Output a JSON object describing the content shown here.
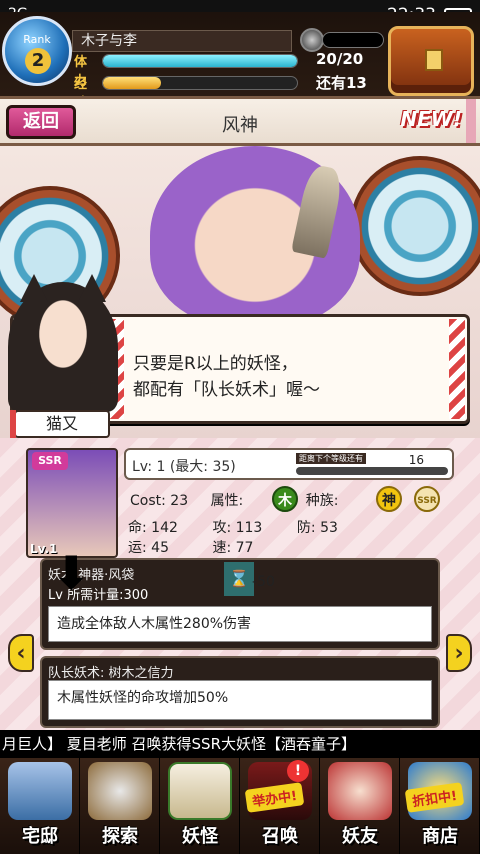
{
  "status_bar": {
    "signal": "2G",
    "time": "22:33"
  },
  "player": {
    "rank_label": "Rank",
    "rank": "2",
    "name": "木子与李",
    "stamina_label": "体力",
    "stamina_value": "20/20",
    "stamina_fraction": 1.0,
    "exp_label": "经验",
    "exp_value": "还有13",
    "exp_fraction": 0.3
  },
  "titlebar": {
    "back_label": "返回",
    "title": "风神",
    "new_badge": "NEW!"
  },
  "dialog": {
    "speaker": "猫又",
    "line1": "只要是R以上的妖怪，",
    "line2": "都配有「队长妖术」喔～"
  },
  "yokai": {
    "rarity": "SSR",
    "card_level": "Lv.1",
    "level_text": "Lv: 1 (最大: 35)",
    "next_label": "距离下个等级还有",
    "next_value": "16",
    "next_fraction": 0.0,
    "cost_text": "Cost: 23",
    "attr_label": "属性:",
    "attr_value": "木",
    "race_label": "种族:",
    "race_value": "神",
    "seal_text": "SSR",
    "stats_line1": [
      "命: 142",
      "攻: 113",
      "防: 53"
    ],
    "stats_line2": [
      "运: 45",
      "速: 77"
    ]
  },
  "skills": {
    "skill1_head": "妖术 神器·风袋",
    "skill1_sub": "Lv  所需计量:300",
    "skill1_gauge": "-50",
    "skill1_desc": "造成全体敌人木属性280%伤害",
    "skill2_head": "队长妖术: 树木之信力",
    "skill2_desc": "木属性妖怪的命攻增加50%"
  },
  "ticker": "月巨人】  夏目老师 召唤获得SSR大妖怪【酒吞童子】",
  "nav": [
    {
      "label": "宅邸"
    },
    {
      "label": "探索"
    },
    {
      "label": "妖怪"
    },
    {
      "label": "召唤",
      "tag": "举办中!"
    },
    {
      "label": "妖友"
    },
    {
      "label": "商店",
      "tag": "折扣中!"
    }
  ],
  "colors": {
    "accent": "#b22a6c",
    "stamina": "#2bb4cf",
    "exp": "#e29a1b",
    "wood": "#3a8a1c"
  }
}
